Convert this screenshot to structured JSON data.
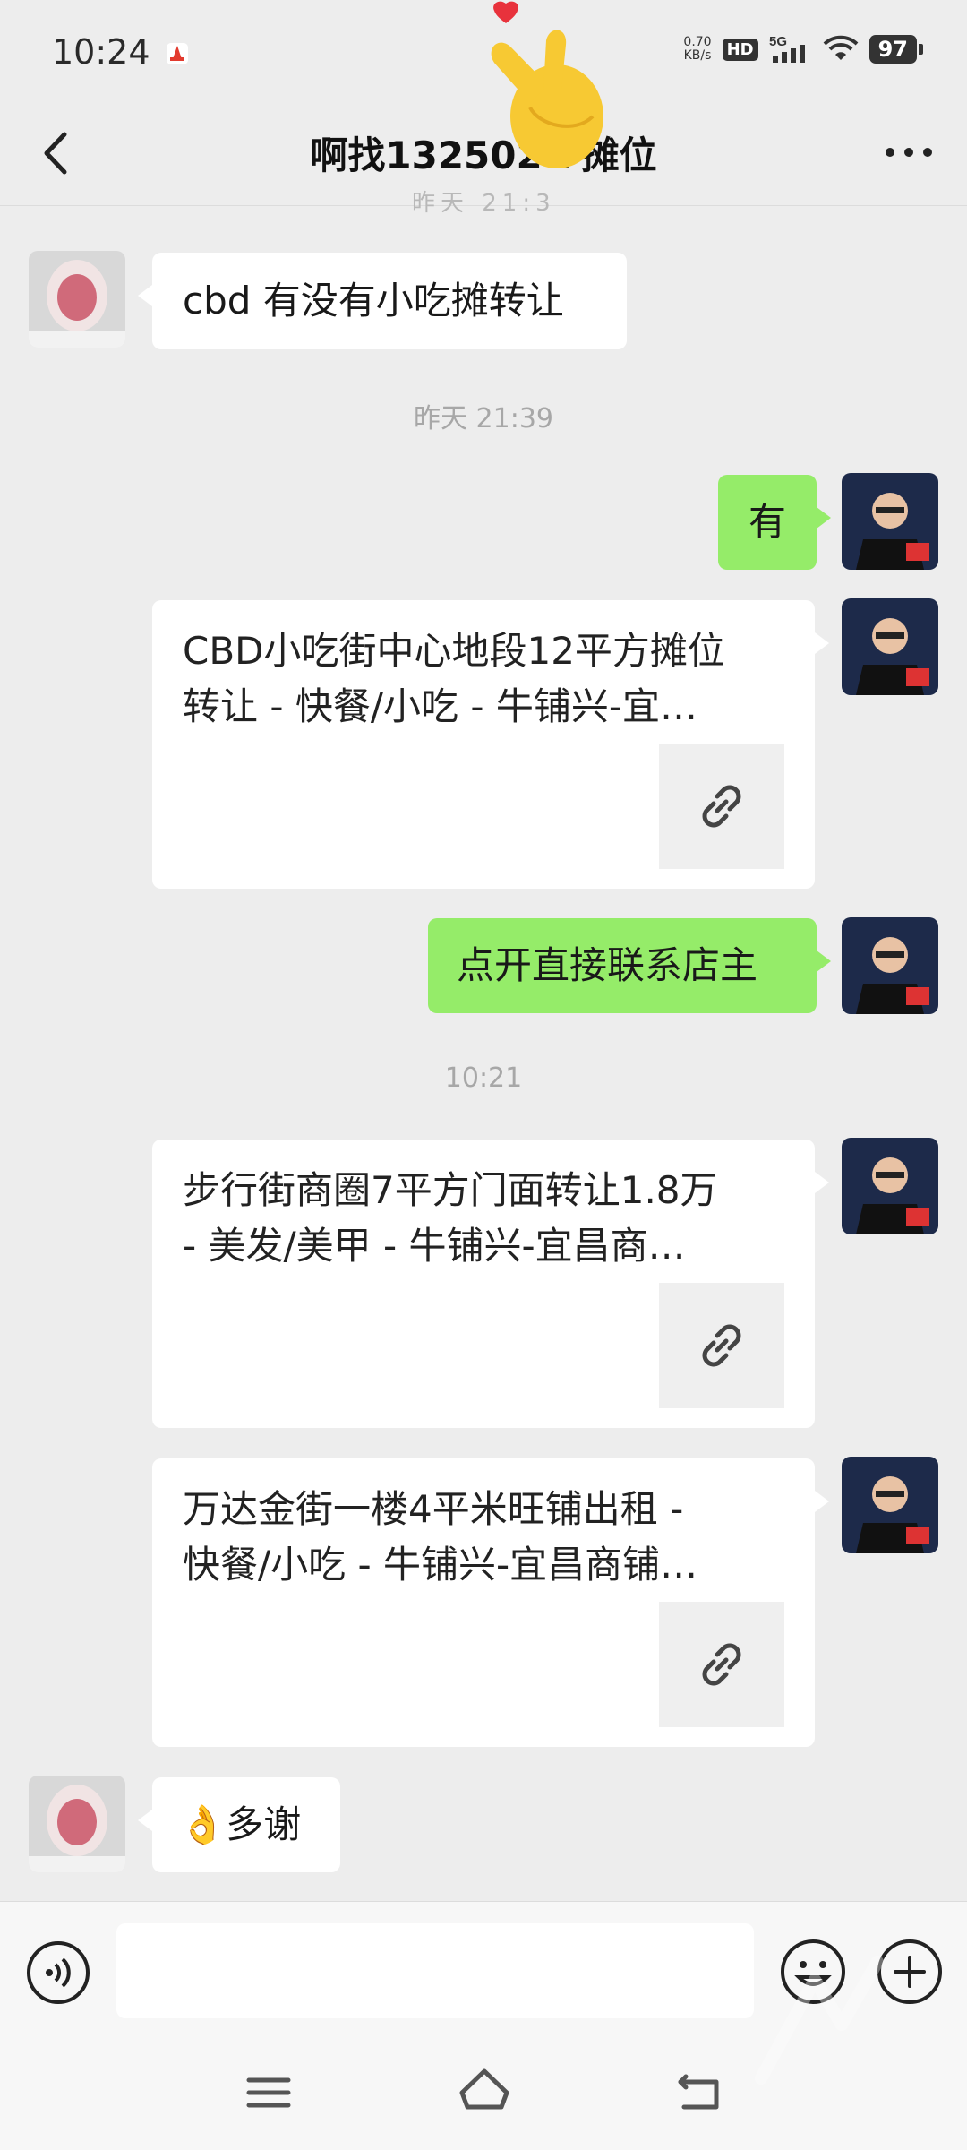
{
  "status_bar": {
    "time": "10:24",
    "net_speed_value": "0.70",
    "net_speed_unit": "KB/s",
    "hd": "HD",
    "network": "5G",
    "battery": "97"
  },
  "header": {
    "title": "啊找132502    7摊位",
    "partial_hidden_text": "昨天 21:3"
  },
  "messages": [
    {
      "side": "left",
      "type": "text",
      "text": "cbd 有没有小吃摊转让"
    },
    {
      "type": "timestamp",
      "text": "昨天 21:39"
    },
    {
      "side": "right",
      "type": "text",
      "text": "有"
    },
    {
      "side": "right",
      "type": "link",
      "title_line1": "CBD小吃街中心地段12平方摊位",
      "title_line2": "转让 - 快餐/小吃 - 牛铺兴-宜…"
    },
    {
      "side": "right",
      "type": "text",
      "text": "点开直接联系店主"
    },
    {
      "type": "timestamp",
      "text": "10:21"
    },
    {
      "side": "right",
      "type": "link",
      "title_line1": "步行街商圈7平方门面转让1.8万",
      "title_line2": "- 美发/美甲 - 牛铺兴-宜昌商…"
    },
    {
      "side": "right",
      "type": "link",
      "title_line1": "万达金街一楼4平米旺铺出租 -",
      "title_line2": "快餐/小吃 - 牛铺兴-宜昌商铺…"
    },
    {
      "side": "left",
      "type": "text",
      "emoji": "👌",
      "text": "多谢"
    }
  ],
  "colors": {
    "background": "#ededed",
    "bubble_green": "#95ec69",
    "bubble_white": "#ffffff",
    "timestamp_text": "#a7a7a7"
  },
  "icons": {
    "back": "back-arrow-icon",
    "more": "more-dots-icon",
    "link": "link-icon",
    "voice": "voice-icon",
    "emoji": "emoji-icon",
    "plus": "plus-icon"
  }
}
